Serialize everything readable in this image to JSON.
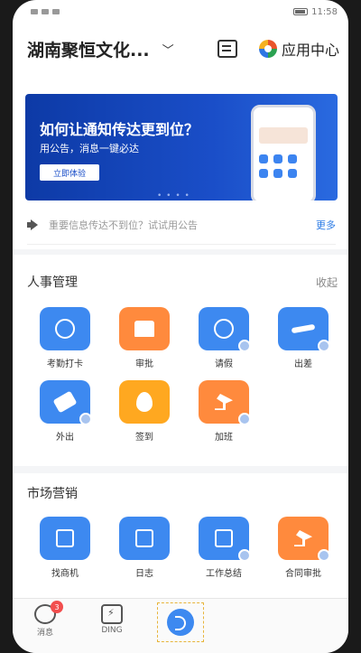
{
  "status_bar": {
    "time": "11:58"
  },
  "header": {
    "org_name": "湖南聚恒文化...",
    "app_center_label": "应用中心"
  },
  "banner": {
    "title": "如何让通知传达更到位？",
    "subtitle": "用公告，消息一键必达",
    "button_label": "立即体验"
  },
  "notice": {
    "text": "重要信息传达不到位？试试用公告",
    "more_label": "更多"
  },
  "hr_section": {
    "title": "人事管理",
    "collapse_label": "收起",
    "apps": [
      {
        "label": "考勤打卡",
        "icon": "clock-in-icon",
        "color": "blue"
      },
      {
        "label": "审批",
        "icon": "stamp-icon",
        "color": "orange"
      },
      {
        "label": "请假",
        "icon": "leave-clock-icon",
        "color": "blue"
      },
      {
        "label": "出差",
        "icon": "airplane-icon",
        "color": "blue"
      },
      {
        "label": "外出",
        "icon": "handshake-icon",
        "color": "blue"
      },
      {
        "label": "签到",
        "icon": "location-pin-icon",
        "color": "amber"
      },
      {
        "label": "加班",
        "icon": "lamp-icon",
        "color": "orange"
      }
    ]
  },
  "marketing_section": {
    "title": "市场营销",
    "apps": [
      {
        "label": "找商机",
        "icon": "business-icon",
        "color": "blue"
      },
      {
        "label": "日志",
        "icon": "journal-icon",
        "color": "blue"
      },
      {
        "label": "工作总结",
        "icon": "summary-icon",
        "color": "blue"
      },
      {
        "label": "合同审批",
        "icon": "contract-icon",
        "color": "orange"
      }
    ]
  },
  "tabbar": {
    "messages_label": "消息",
    "messages_unread": "3",
    "ding_label": "DING"
  },
  "colors": {
    "accent": "#3d89f0",
    "orange": "#ff8a3d",
    "banner": "#1a4ec8",
    "link": "#2c7be5"
  }
}
